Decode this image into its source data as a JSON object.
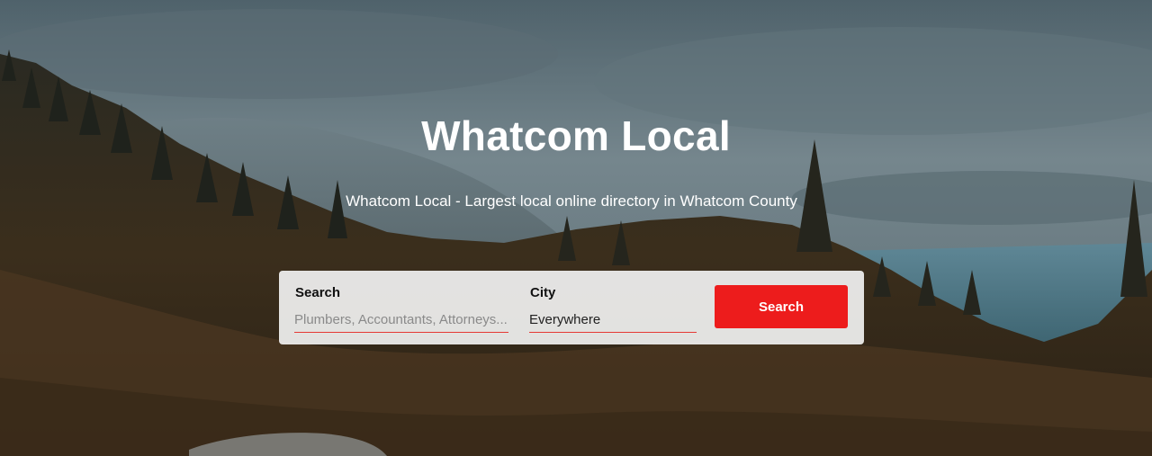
{
  "hero": {
    "title": "Whatcom Local",
    "subtitle": "Whatcom Local - Largest local online directory in Whatcom County"
  },
  "search": {
    "search_label": "Search",
    "search_placeholder": "Plumbers, Accountants, Attorneys...",
    "search_value": "",
    "city_label": "City",
    "city_value": "Everywhere",
    "button_label": "Search"
  },
  "colors": {
    "accent": "#ed1c1c",
    "underline": "#e53935",
    "panel": "#f0f0f0"
  }
}
